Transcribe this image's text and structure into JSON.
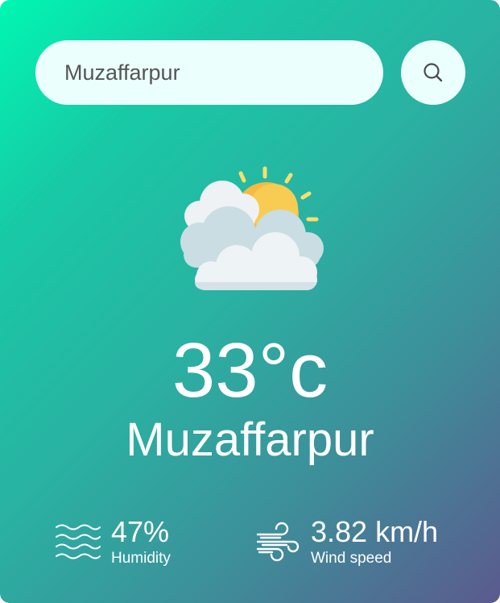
{
  "search": {
    "value": "Muzaffarpur",
    "button_icon": "search-icon"
  },
  "weather": {
    "icon": "partly-cloudy-icon",
    "temperature": "33°c",
    "city": "Muzaffarpur"
  },
  "details": {
    "humidity": {
      "icon": "humidity-waves-icon",
      "value": "47%",
      "label": "Humidity"
    },
    "wind": {
      "icon": "wind-icon",
      "value": "3.82 km/h",
      "label": "Wind speed"
    }
  }
}
